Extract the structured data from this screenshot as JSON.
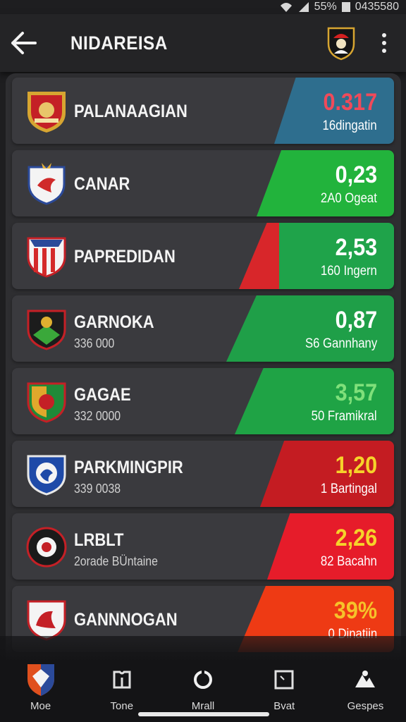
{
  "status": {
    "battery": "55%",
    "time": "0435580"
  },
  "header": {
    "title": "NIDAREISA"
  },
  "rows": [
    {
      "name": "PALANAAGIAN",
      "sub": "",
      "odds": "0.317",
      "label": "16dingatin",
      "box_color": "#2e6e8e",
      "value_color": "#f04a5a"
    },
    {
      "name": "CANAR",
      "sub": "",
      "odds": "0,23",
      "label": "2A0 Ogeat",
      "box_color": "#22b33c",
      "value_color": "#ffffff"
    },
    {
      "name": "PAPREDIDAN",
      "sub": "",
      "odds": "2,53",
      "label": "160 Ingern",
      "box_color": "#1fa34a",
      "value_color": "#ffffff"
    },
    {
      "name": "GARNOKA",
      "sub": "336 000",
      "odds": "0,87",
      "label": "S6 Gannhany",
      "box_color": "#1f9f48",
      "value_color": "#ffffff"
    },
    {
      "name": "GAGAE",
      "sub": "332 0000",
      "odds": "3,57",
      "label": "50 Framikral",
      "box_color": "#1fa345",
      "value_color": "#7fe07a"
    },
    {
      "name": "PARKMINGPIR",
      "sub": "339 0038",
      "odds": "1,20",
      "label": "1 Bartingal",
      "box_color": "#c41c22",
      "value_color": "#f6d32a"
    },
    {
      "name": "LRBLT",
      "sub": "2orade BÜntaine",
      "odds": "2,26",
      "label": "82 Bacahn",
      "box_color": "#e61c2a",
      "value_color": "#f6d32a"
    },
    {
      "name": "GANNNOGAN",
      "sub": "",
      "odds": "39%",
      "label": "0 Dinatiin",
      "box_color": "#ee3a14",
      "value_color": "#f6c22a"
    }
  ],
  "nav": [
    {
      "label": "Moe",
      "icon": "team-crest-icon"
    },
    {
      "label": "Tone",
      "icon": "jersey-icon"
    },
    {
      "label": "Mrall",
      "icon": "ring-icon"
    },
    {
      "label": "Bvat",
      "icon": "square-icon"
    },
    {
      "label": "Gespes",
      "icon": "people-icon"
    }
  ]
}
